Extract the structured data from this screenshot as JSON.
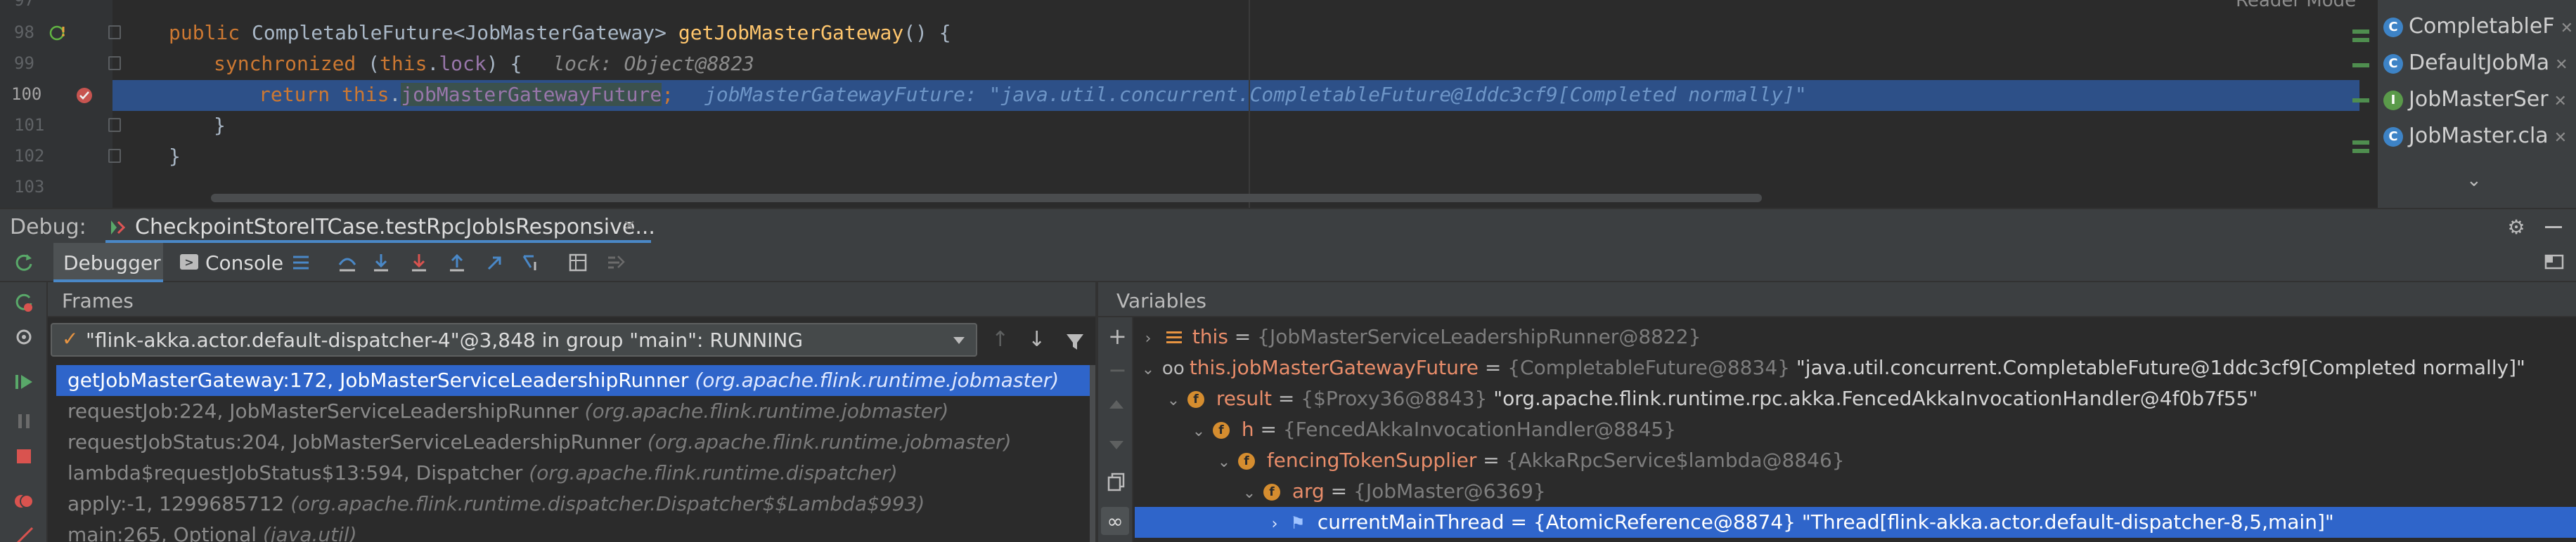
{
  "editor": {
    "reader_mode": "Reader Mode",
    "lines": [
      {
        "num": "97"
      },
      {
        "num": "98",
        "kw": "public ",
        "type": "CompletableFuture<JobMasterGateway> ",
        "fn": "getJobMasterGateway",
        "rest": "() {"
      },
      {
        "num": "99",
        "kw": "synchronized",
        "rest1": " (",
        "kw2": "this",
        "rest2": ".",
        "fld": "lock",
        "rest3": ") {",
        "hint": "lock: Object@8823"
      },
      {
        "num": "100",
        "kw": "return ",
        "kw2": "this",
        "rest": ".",
        "fld": "jobMasterGatewayFuture",
        "semi": ";",
        "hint": "jobMasterGatewayFuture: \"java.util.concurrent.CompletableFuture@1ddc3cf9[Completed normally]\""
      },
      {
        "num": "101",
        "rest": "}"
      },
      {
        "num": "102",
        "rest": "}"
      },
      {
        "num": "103"
      }
    ]
  },
  "right_tabs": [
    {
      "letter": "C",
      "label": "CompletableF",
      "color": "#3d83c6"
    },
    {
      "letter": "C",
      "label": "DefaultJobMa",
      "color": "#3d83c6"
    },
    {
      "letter": "I",
      "label": "JobMasterSer",
      "color": "#5a9a4a"
    },
    {
      "letter": "C",
      "label": "JobMaster.cla",
      "color": "#3d83c6"
    }
  ],
  "debug": {
    "label": "Debug:",
    "session_tab": "CheckpointStoreITCase.testRpcJobIsResponsive...",
    "tabs": {
      "debugger": "Debugger",
      "console": "Console"
    },
    "frames_title": "Frames",
    "variables_title": "Variables",
    "thread": "\"flink-akka.actor.default-dispatcher-4\"@3,848 in group \"main\": RUNNING",
    "frames": [
      {
        "fn": "getJobMasterGateway:172, JobMasterServiceLeadershipRunner",
        "pkg": "(org.apache.flink.runtime.jobmaster)"
      },
      {
        "fn": "requestJob:224, JobMasterServiceLeadershipRunner",
        "pkg": "(org.apache.flink.runtime.jobmaster)"
      },
      {
        "fn": "requestJobStatus:204, JobMasterServiceLeadershipRunner",
        "pkg": "(org.apache.flink.runtime.jobmaster)"
      },
      {
        "fn": "lambda$requestJobStatus$13:594, Dispatcher",
        "pkg": "(org.apache.flink.runtime.dispatcher)"
      },
      {
        "fn": "apply:-1, 1299685712",
        "pkg": "(org.apache.flink.runtime.dispatcher.Dispatcher$$Lambda$993)"
      },
      {
        "fn": "main:265, Optional",
        "pkg": "(java.util)"
      }
    ],
    "variables": [
      {
        "name": "this",
        "ref": "{JobMasterServiceLeadershipRunner@8822}",
        "val": ""
      },
      {
        "name": "this.jobMasterGatewayFuture",
        "ref": "{CompletableFuture@8834}",
        "val": "\"java.util.concurrent.CompletableFuture@1ddc3cf9[Completed normally]\""
      },
      {
        "name": "result",
        "ref": "{$Proxy36@8843}",
        "val": "\"org.apache.flink.runtime.rpc.akka.FencedAkkaInvocationHandler@4f0b7f55\""
      },
      {
        "name": "h",
        "ref": "{FencedAkkaInvocationHandler@8845}",
        "val": ""
      },
      {
        "name": "fencingTokenSupplier",
        "ref": "{AkkaRpcService$lambda@8846}",
        "val": ""
      },
      {
        "name": "arg",
        "ref": "{JobMaster@6369}",
        "val": ""
      },
      {
        "name": "currentMainThread",
        "ref": "{AtomicReference@8874}",
        "val": "\"Thread[flink-akka.actor.default-dispatcher-8,5,main]\""
      }
    ],
    "eq": " = "
  }
}
